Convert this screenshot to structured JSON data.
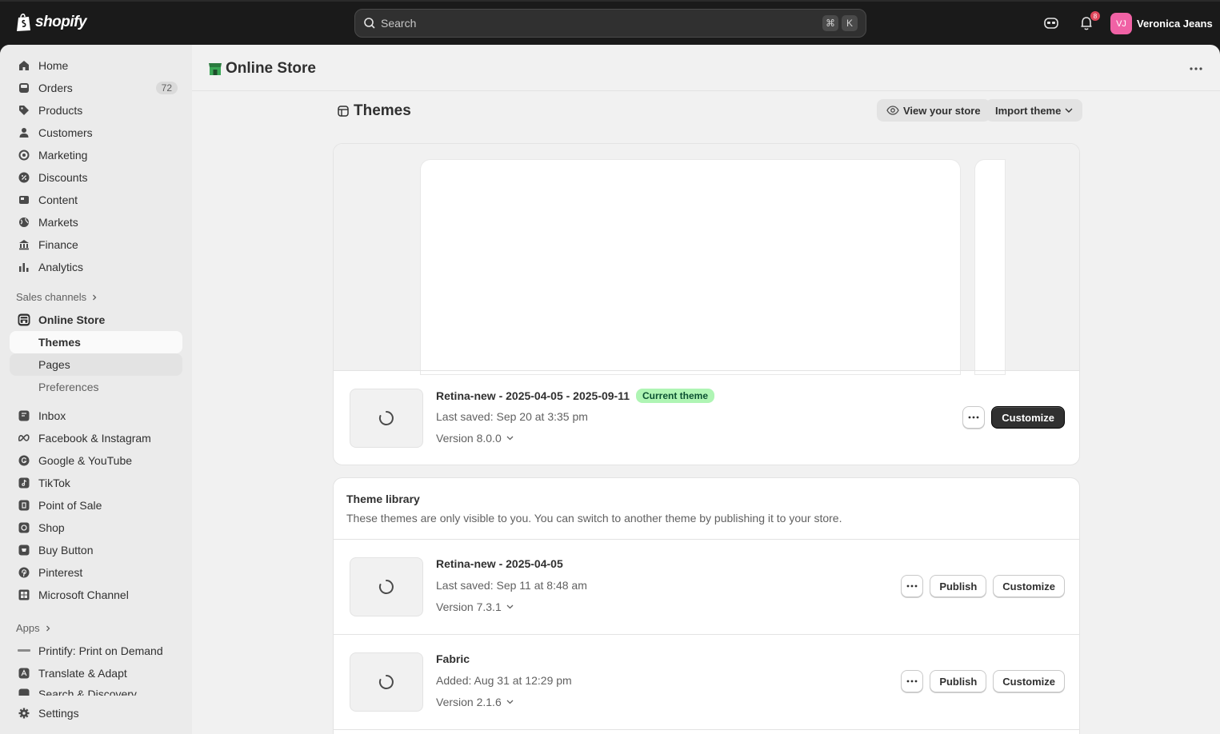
{
  "topbar": {
    "logo_text": "shopify",
    "search_placeholder": "Search",
    "shortcut_keys": [
      "⌘",
      "K"
    ],
    "notification_count": "8",
    "user_initials": "VJ",
    "user_name": "Veronica Jeans",
    "colors": {
      "bar": "#1a1a1a",
      "avatar": "#f062a5",
      "badge": "#e0475b"
    }
  },
  "sidebar": {
    "main_items": [
      {
        "label": "Home",
        "icon": "home-icon"
      },
      {
        "label": "Orders",
        "icon": "orders-icon",
        "count": "72"
      },
      {
        "label": "Products",
        "icon": "tag-icon"
      },
      {
        "label": "Customers",
        "icon": "person-icon"
      },
      {
        "label": "Marketing",
        "icon": "target-icon"
      },
      {
        "label": "Discounts",
        "icon": "discount-icon"
      },
      {
        "label": "Content",
        "icon": "content-icon"
      },
      {
        "label": "Markets",
        "icon": "globe-icon"
      },
      {
        "label": "Finance",
        "icon": "bank-icon"
      },
      {
        "label": "Analytics",
        "icon": "bar-chart-icon"
      }
    ],
    "sales_channels_label": "Sales channels",
    "online_store": {
      "label": "Online Store",
      "icon": "store-icon"
    },
    "online_store_sub": [
      {
        "label": "Themes",
        "active": true
      },
      {
        "label": "Pages"
      },
      {
        "label": "Preferences"
      }
    ],
    "channels": [
      {
        "label": "Inbox",
        "icon": "inbox-icon"
      },
      {
        "label": "Facebook & Instagram",
        "icon": "meta-icon"
      },
      {
        "label": "Google & YouTube",
        "icon": "google-icon"
      },
      {
        "label": "TikTok",
        "icon": "tiktok-icon"
      },
      {
        "label": "Point of Sale",
        "icon": "pos-icon"
      },
      {
        "label": "Shop",
        "icon": "shop-icon"
      },
      {
        "label": "Buy Button",
        "icon": "buy-button-icon"
      },
      {
        "label": "Pinterest",
        "icon": "pinterest-icon"
      },
      {
        "label": "Microsoft Channel",
        "icon": "microsoft-icon"
      }
    ],
    "apps_label": "Apps",
    "apps": [
      {
        "label": "Printify: Print on Demand",
        "icon": "printify-icon"
      },
      {
        "label": "Translate & Adapt",
        "icon": "translate-icon"
      },
      {
        "label": "Search & Discovery",
        "icon": "search-discovery-icon"
      }
    ],
    "settings_label": "Settings"
  },
  "page": {
    "title": "Online Store",
    "section_title": "Themes",
    "view_store_label": "View your store",
    "import_theme_label": "Import theme"
  },
  "current_theme": {
    "name": "Retina-new - 2025-04-05 - 2025-09-11",
    "badge": "Current theme",
    "saved": "Last saved: Sep 20 at 3:35 pm",
    "version": "Version 8.0.0",
    "customize_label": "Customize"
  },
  "library": {
    "title": "Theme library",
    "description": "These themes are only visible to you. You can switch to another theme by publishing it to your store.",
    "themes": [
      {
        "name": "Retina-new - 2025-04-05",
        "saved": "Last saved: Sep 11 at 8:48 am",
        "version": "Version 7.3.1",
        "publish_label": "Publish",
        "customize_label": "Customize"
      },
      {
        "name": "Fabric",
        "saved": "Added: Aug 31 at 12:29 pm",
        "version": "Version 2.1.6",
        "publish_label": "Publish",
        "customize_label": "Customize"
      }
    ]
  }
}
